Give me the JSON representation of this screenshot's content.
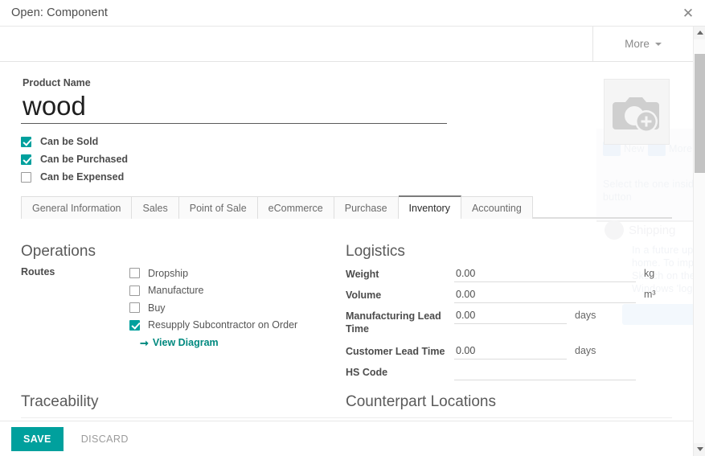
{
  "modal": {
    "title": "Open: Component",
    "close_icon": "close-icon"
  },
  "statusbar": {
    "more_label": "More",
    "caret_icon": "chevron-down-icon"
  },
  "scrollbar": {
    "up_icon": "scroll-up-arrow-icon",
    "down_icon": "scroll-down-arrow-icon"
  },
  "form": {
    "product_name_label": "Product Name",
    "product_name_value": "wood",
    "product_name_placeholder": "Product Name",
    "image_placeholder_icon": "camera-add-photo-icon",
    "checkboxes": [
      {
        "label": "Can be Sold",
        "checked": true
      },
      {
        "label": "Can be Purchased",
        "checked": true
      },
      {
        "label": "Can be Expensed",
        "checked": false
      }
    ]
  },
  "tabs": [
    {
      "label": "General Information",
      "active": false
    },
    {
      "label": "Sales",
      "active": false
    },
    {
      "label": "Point of Sale",
      "active": false
    },
    {
      "label": "eCommerce",
      "active": false
    },
    {
      "label": "Purchase",
      "active": false
    },
    {
      "label": "Inventory",
      "active": true
    },
    {
      "label": "Accounting",
      "active": false
    }
  ],
  "inventory": {
    "operations": {
      "title": "Operations",
      "routes_label": "Routes",
      "routes": [
        {
          "label": "Dropship",
          "checked": false
        },
        {
          "label": "Manufacture",
          "checked": false
        },
        {
          "label": "Buy",
          "checked": false
        },
        {
          "label": "Resupply Subcontractor on Order",
          "checked": true
        }
      ],
      "view_diagram_label": "View Diagram",
      "view_diagram_icon": "arrow-right-icon"
    },
    "logistics": {
      "title": "Logistics",
      "fields": [
        {
          "label": "Weight",
          "value": "0.00",
          "unit": "kg"
        },
        {
          "label": "Volume",
          "value": "0.00",
          "unit": "m³"
        },
        {
          "label": "Manufacturing Lead Time",
          "value": "0.00",
          "unit": "days"
        },
        {
          "label": "Customer Lead Time",
          "value": "0.00",
          "unit": "days"
        },
        {
          "label": "HS Code",
          "value": "",
          "unit": ""
        }
      ]
    },
    "traceability_title": "Traceability",
    "counterpart_title": "Counterpart Locations"
  },
  "footer": {
    "save_label": "SAVE",
    "discard_label": "DISCARD"
  },
  "colors": {
    "accent": "#00a09d",
    "link": "#00897f",
    "text": "#4c4c4c"
  }
}
